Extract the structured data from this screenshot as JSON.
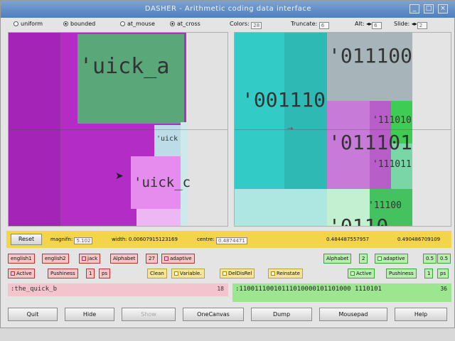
{
  "window": {
    "title": "DASHER - Arithmetic coding data interface"
  },
  "titlebar_buttons": [
    "_",
    "□",
    "×"
  ],
  "topbar": {
    "uniform": "uniform",
    "bounded": "bounded",
    "at_mouse": "at_mouse",
    "at_cross": "at_cross",
    "colors_label": "Colors:",
    "colors_value": "28",
    "truncate_label": "Truncate:",
    "truncate_value": "6",
    "alt_label": "Alt:",
    "alt_value": "6",
    "slide_label": "Slide:",
    "slide_value": "2"
  },
  "left_canvas": {
    "labels": [
      "'uick_a",
      "'uick",
      "'uick_c"
    ]
  },
  "right_canvas": {
    "labels": [
      "'011100",
      "'001110",
      "'011101",
      "'111010",
      "'111011",
      "'11100",
      "'0110"
    ]
  },
  "yellowbar": {
    "reset": "Reset",
    "magnifn_label": "magnifn:",
    "magnifn_value": "5.102",
    "width_label": "width:",
    "width_value": "0.00607915123169",
    "centre_label": "centre:",
    "centre_value": "0.4874471",
    "left_bound": "0.484487557957",
    "right_bound": "0.490486709109"
  },
  "left_controls": {
    "english1": "english1",
    "english2": "english2",
    "jack": "jack",
    "alphabet_label": "Alphabet",
    "alphabet_value": "27",
    "adaptive": "adaptive",
    "active": "Active",
    "pushiness_label": "Pushiness",
    "pushiness_value": "1",
    "ps": "ps",
    "text": ":the_quick_b",
    "count": "18"
  },
  "middle_controls": {
    "clean": "Clean",
    "variable": "Variable.",
    "deldisrel": "DelDisRel",
    "reinstate": "Reinstate"
  },
  "right_controls": {
    "alphabet_label": "Alphabet",
    "alphabet_value": "2",
    "adaptive": "adaptive",
    "p0": "0.5",
    "p1": "0.5",
    "active": "Active",
    "pushiness_label": "Pushiness",
    "pushiness_value": "1",
    "ps": "ps",
    "text": ":11001110010111010000101101000 1110101",
    "count": "36"
  },
  "bottom_buttons": {
    "quit": "Quit",
    "hide": "Hide",
    "show": "Show",
    "onecanvas": "OneCanvas",
    "dump": "Dump",
    "mousepad": "Mousepad",
    "help": "Help"
  }
}
